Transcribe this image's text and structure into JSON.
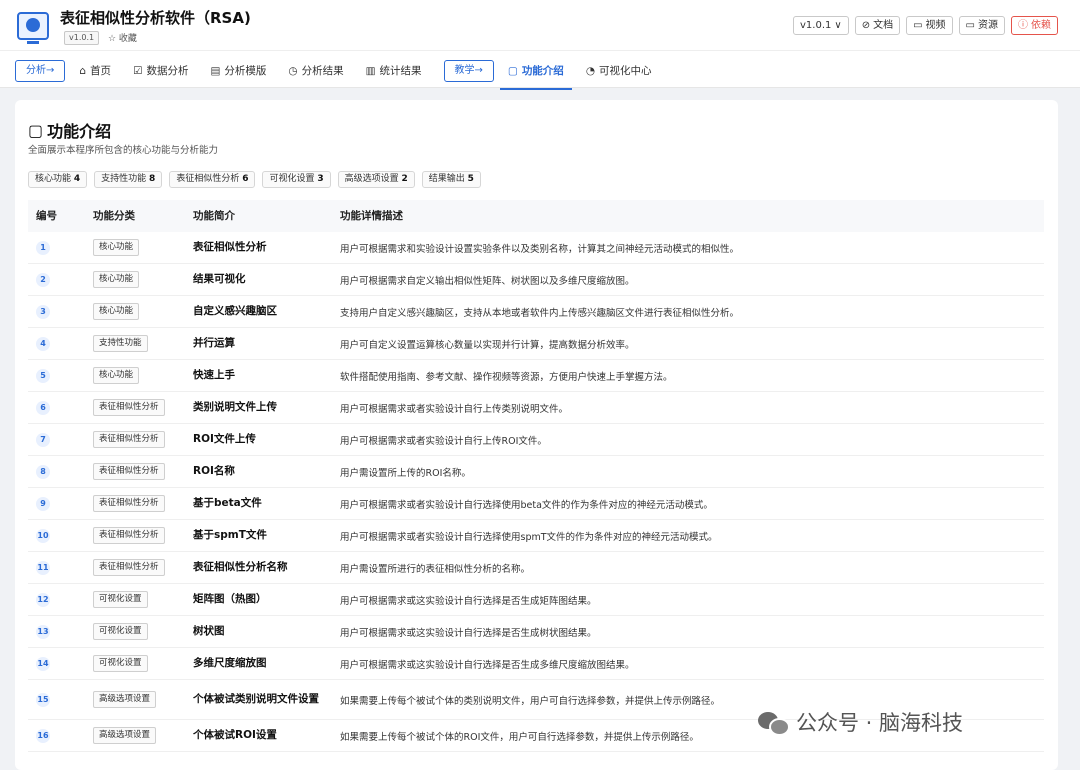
{
  "header": {
    "title": "表征相似性分析软件（RSA)",
    "version_tag": "v1.0.1",
    "favorite": "☆ 收藏",
    "version_select": "v1.0.1",
    "docs": "文档",
    "video": "视频",
    "resources": "资源",
    "dependencies": "依赖"
  },
  "nav": {
    "analysis_button": "分析→",
    "home": "首页",
    "data_analysis": "数据分析",
    "analysis_template": "分析模版",
    "analysis_results": "分析结果",
    "stat_results": "统计结果",
    "teaching_button": "教学→",
    "features": "功能介绍",
    "visual_center": "可视化中心"
  },
  "page": {
    "title": "功能介绍",
    "subtitle": "全面展示本程序所包含的核心功能与分析能力"
  },
  "stats": [
    {
      "label": "核心功能",
      "count": "4"
    },
    {
      "label": "支持性功能",
      "count": "8"
    },
    {
      "label": "表征相似性分析",
      "count": "6"
    },
    {
      "label": "可视化设置",
      "count": "3"
    },
    {
      "label": "高级选项设置",
      "count": "2"
    },
    {
      "label": "结果输出",
      "count": "5"
    }
  ],
  "table": {
    "headers": [
      "编号",
      "功能分类",
      "功能简介",
      "功能详情描述"
    ],
    "rows": [
      {
        "no": "1",
        "category": "核心功能",
        "name": "表征相似性分析",
        "desc": "用户可根据需求和实验设计设置实验条件以及类别名称，计算其之间神经元活动模式的相似性。"
      },
      {
        "no": "2",
        "category": "核心功能",
        "name": "结果可视化",
        "desc": "用户可根据需求自定义输出相似性矩阵、树状图以及多维尺度缩放图。"
      },
      {
        "no": "3",
        "category": "核心功能",
        "name": "自定义感兴趣脑区",
        "desc": "支持用户自定义感兴趣脑区，支持从本地或者软件内上传感兴趣脑区文件进行表征相似性分析。"
      },
      {
        "no": "4",
        "category": "支持性功能",
        "name": "并行运算",
        "desc": "用户可自定义设置运算核心数量以实现并行计算，提高数据分析效率。"
      },
      {
        "no": "5",
        "category": "核心功能",
        "name": "快速上手",
        "desc": "软件搭配使用指南、参考文献、操作视频等资源，方便用户快速上手掌握方法。"
      },
      {
        "no": "6",
        "category": "表征相似性分析",
        "name": "类别说明文件上传",
        "desc": "用户可根据需求或者实验设计自行上传类别说明文件。"
      },
      {
        "no": "7",
        "category": "表征相似性分析",
        "name": "ROI文件上传",
        "desc": "用户可根据需求或者实验设计自行上传ROI文件。"
      },
      {
        "no": "8",
        "category": "表征相似性分析",
        "name": "ROI名称",
        "desc": "用户需设置所上传的ROI名称。"
      },
      {
        "no": "9",
        "category": "表征相似性分析",
        "name": "基于beta文件",
        "desc": "用户可根据需求或者实验设计自行选择使用beta文件的作为条件对应的神经元活动模式。"
      },
      {
        "no": "10",
        "category": "表征相似性分析",
        "name": "基于spmT文件",
        "desc": "用户可根据需求或者实验设计自行选择使用spmT文件的作为条件对应的神经元活动模式。"
      },
      {
        "no": "11",
        "category": "表征相似性分析",
        "name": "表征相似性分析名称",
        "desc": "用户需设置所进行的表征相似性分析的名称。"
      },
      {
        "no": "12",
        "category": "可视化设置",
        "name": "矩阵图（热图）",
        "desc": "用户可根据需求或这实验设计自行选择是否生成矩阵图结果。"
      },
      {
        "no": "13",
        "category": "可视化设置",
        "name": "树状图",
        "desc": "用户可根据需求或这实验设计自行选择是否生成树状图结果。"
      },
      {
        "no": "14",
        "category": "可视化设置",
        "name": "多维尺度缩放图",
        "desc": "用户可根据需求或这实验设计自行选择是否生成多维尺度缩放图结果。"
      },
      {
        "no": "15",
        "category": "高级选项设置",
        "name": "个体被试类别说明文件设置",
        "desc": "如果需要上传每个被试个体的类别说明文件，用户可自行选择参数，并提供上传示例路径。"
      },
      {
        "no": "16",
        "category": "高级选项设置",
        "name": "个体被试ROI设置",
        "desc": "如果需要上传每个被试个体的ROI文件，用户可自行选择参数，并提供上传示例路径。"
      }
    ]
  },
  "watermark": {
    "text": "公众号 · 脑海科技"
  }
}
